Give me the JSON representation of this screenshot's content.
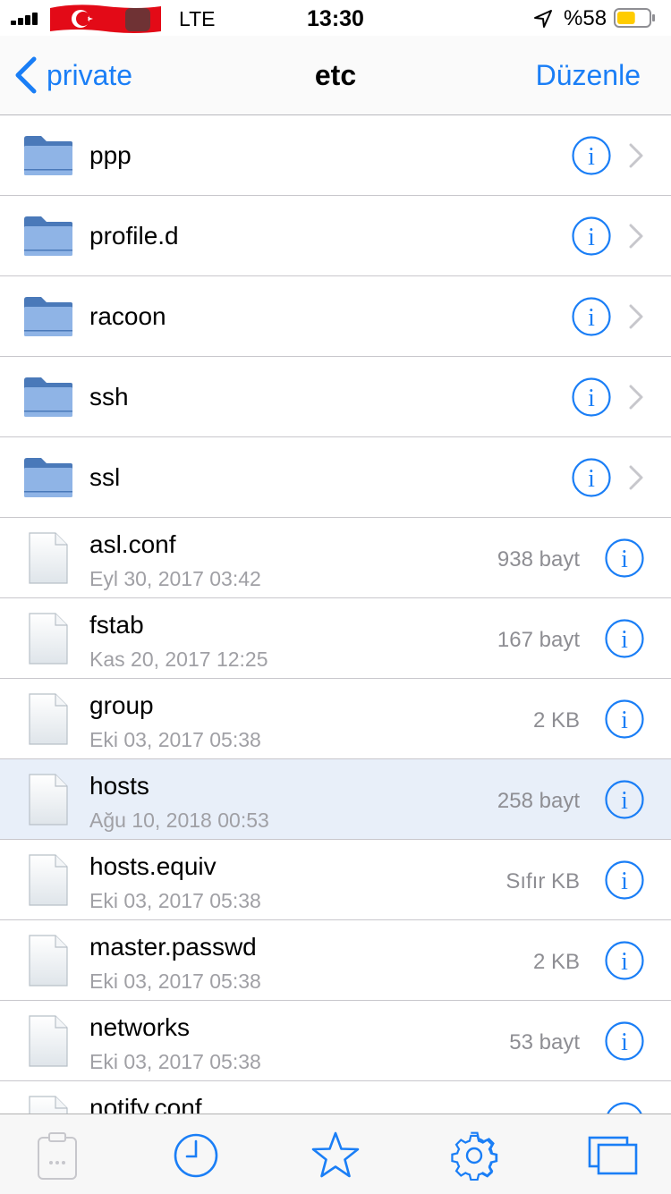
{
  "status_bar": {
    "carrier": "LTE",
    "time": "13:30",
    "battery": "%58",
    "battery_level": 0.58,
    "colors": {
      "flag_red": "#e30a17",
      "battery_yellow": "#ffcc00"
    }
  },
  "nav": {
    "back_label": "private",
    "title": "etc",
    "edit_label": "Düzenle",
    "accent_color": "#1a7ef6"
  },
  "folders": [
    {
      "name": "ppp"
    },
    {
      "name": "profile.d"
    },
    {
      "name": "racoon"
    },
    {
      "name": "ssh"
    },
    {
      "name": "ssl"
    }
  ],
  "files": [
    {
      "name": "asl.conf",
      "date": "Eyl 30, 2017 03:42",
      "size": "938 bayt"
    },
    {
      "name": "fstab",
      "date": "Kas 20, 2017 12:25",
      "size": "167 bayt"
    },
    {
      "name": "group",
      "date": "Eki 03, 2017 05:38",
      "size": "2 KB"
    },
    {
      "name": "hosts",
      "date": "Ağu 10, 2018 00:53",
      "size": "258 bayt",
      "selected": true
    },
    {
      "name": "hosts.equiv",
      "date": "Eki 03, 2017 05:38",
      "size": "Sıfır KB"
    },
    {
      "name": "master.passwd",
      "date": "Eki 03, 2017 05:38",
      "size": "2 KB"
    },
    {
      "name": "networks",
      "date": "Eki 03, 2017 05:38",
      "size": "53 bayt"
    },
    {
      "name": "notify.conf",
      "date": "",
      "size": ""
    }
  ],
  "tab_bar": {
    "tabs": [
      "clipboard-icon",
      "history-icon",
      "star-icon",
      "gear-icon",
      "windows-icon"
    ]
  }
}
